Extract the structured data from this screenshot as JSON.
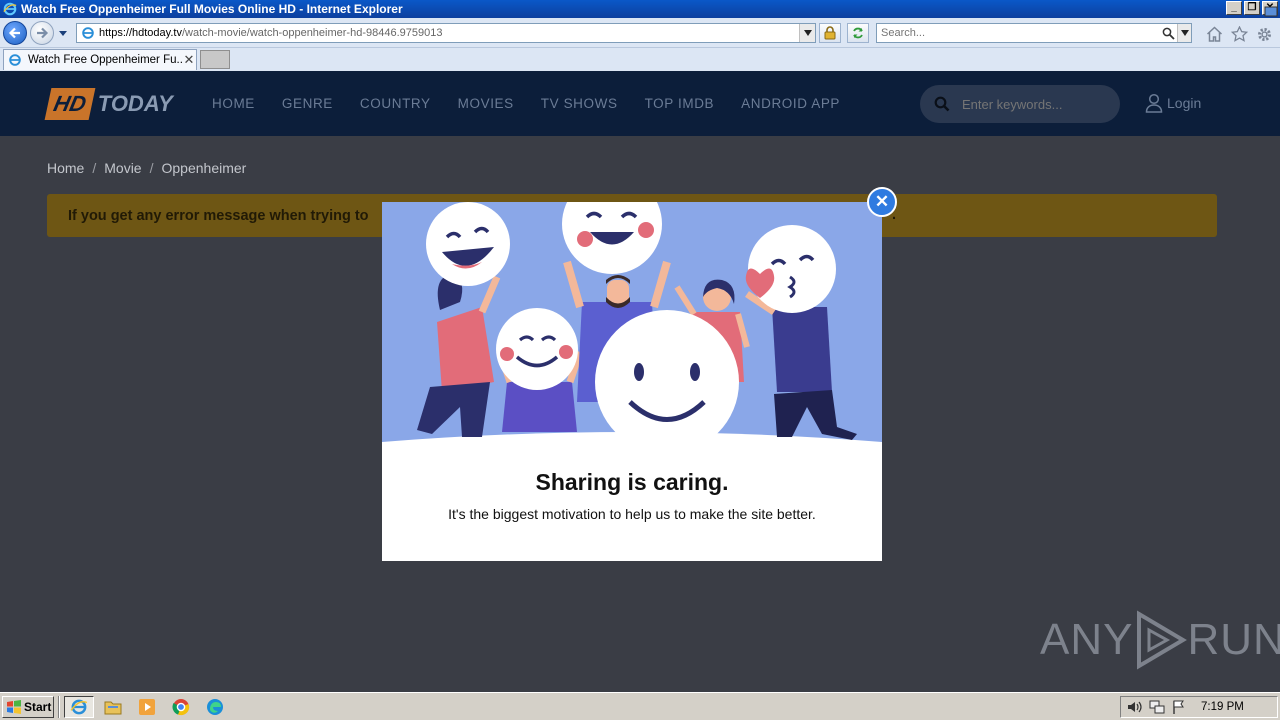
{
  "window": {
    "title": "Watch Free Oppenheimer Full Movies Online HD - Internet Explorer",
    "buttons": {
      "minimize": "_",
      "maximize": "❐",
      "close": "✕"
    }
  },
  "address_bar": {
    "url_host": "https://hdtoday.tv",
    "url_path": "/watch-movie/watch-oppenheimer-hd-98446.9759013",
    "search_placeholder": "Search..."
  },
  "tabs": [
    {
      "title": "Watch Free Oppenheimer Fu...",
      "close": "✕"
    }
  ],
  "site": {
    "logo_hd": "HD",
    "logo_today": "TODAY",
    "nav": [
      "HOME",
      "GENRE",
      "COUNTRY",
      "MOVIES",
      "TV SHOWS",
      "TOP IMDB",
      "ANDROID APP"
    ],
    "search_placeholder": "Enter keywords...",
    "login_label": "Login"
  },
  "breadcrumb": [
    "Home",
    "Movie",
    "Oppenheimer"
  ],
  "breadcrumb_sep": "/",
  "alert": {
    "text": "If you get any error message when trying to",
    "tail": "."
  },
  "modal": {
    "close": "✕",
    "heading": "Sharing is caring.",
    "text": "It's the biggest motivation to help us to make the site better."
  },
  "watermark": {
    "left": "ANY",
    "right": "RUN"
  },
  "taskbar": {
    "start_label": "Start",
    "clock": "7:19 PM"
  },
  "colors": {
    "site_header_bg": "#0c1e3a",
    "page_bg": "#3a3d45",
    "alert_bg": "#6e5614",
    "modal_illustration_bg": "#8aa7e8",
    "modal_close_bg": "#2f7be0"
  }
}
